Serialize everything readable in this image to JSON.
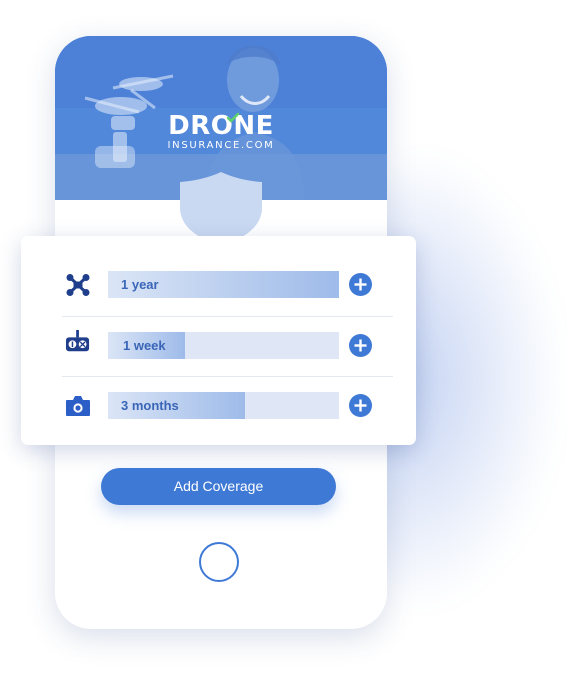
{
  "brand": {
    "logo_main": "DRONE",
    "logo_sub": "INSURANCE.COM",
    "accent_color": "#3f79d6",
    "check_color": "#5fd06a"
  },
  "coverage": {
    "items": [
      {
        "icon": "drone-icon",
        "label": "1 year",
        "fill_percent": 100
      },
      {
        "icon": "remote-controller-icon",
        "label": "1 week",
        "fill_percent": 33
      },
      {
        "icon": "camera-icon",
        "label": "3 months",
        "fill_percent": 59
      }
    ],
    "add_icon": "plus-circle-icon"
  },
  "cta": {
    "label": "Add Coverage"
  }
}
